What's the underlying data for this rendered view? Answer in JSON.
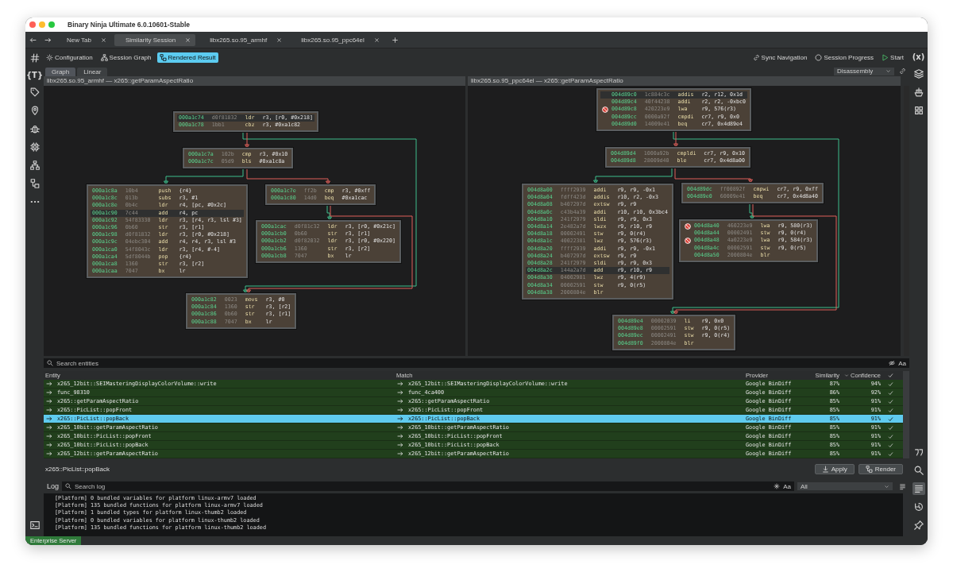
{
  "window": {
    "title": "Binary Ninja Ultimate 6.0.10601-Stable"
  },
  "tabs": [
    {
      "label": "New Tab",
      "selected": false
    },
    {
      "label": "Similarity Session",
      "selected": true
    },
    {
      "label": "libx265.so.95_armhf",
      "selected": false
    },
    {
      "label": "libx265.so.95_ppc64el",
      "selected": false
    }
  ],
  "left_sidebar": {
    "top": [
      {
        "kind": "hash",
        "selected": false
      },
      {
        "kind": "glyph",
        "text": "{T}",
        "selected": false
      },
      {
        "kind": "tag",
        "selected": false
      },
      {
        "kind": "pin",
        "selected": false
      },
      {
        "kind": "bug",
        "selected": false
      },
      {
        "kind": "chip",
        "selected": false
      },
      {
        "kind": "tree",
        "selected": false
      },
      {
        "kind": "tree2",
        "selected": false
      },
      {
        "kind": "more",
        "selected": false
      }
    ],
    "bottom": [
      {
        "kind": "terminal",
        "selected": false
      }
    ]
  },
  "right_sidebar": {
    "top": [
      {
        "kind": "glyph",
        "text": "(x)",
        "selected": false
      },
      {
        "kind": "layers",
        "selected": false
      },
      {
        "kind": "ship",
        "selected": false
      },
      {
        "kind": "grid",
        "selected": false
      }
    ],
    "bottom": [
      {
        "kind": "quote",
        "selected": false
      },
      {
        "kind": "search",
        "selected": false
      },
      {
        "kind": "list",
        "selected": true
      },
      {
        "kind": "history",
        "selected": false
      },
      {
        "kind": "pushpin",
        "selected": false
      }
    ]
  },
  "toolbar": {
    "left": [
      {
        "label": "Configuration",
        "kind": "gear",
        "selected": false
      },
      {
        "label": "Session Graph",
        "kind": "tree",
        "selected": false
      },
      {
        "label": "Rendered Result",
        "kind": "tree2",
        "selected": true
      }
    ],
    "right": [
      {
        "label": "Sync Navigation",
        "kind": "link"
      },
      {
        "label": "Session Progress",
        "kind": "circle"
      },
      {
        "label": "Start",
        "kind": "play"
      }
    ]
  },
  "view_tabs": [
    {
      "label": "Graph",
      "selected": true
    },
    {
      "label": "Linear",
      "selected": false
    }
  ],
  "view_mode": {
    "value": "Disassembly"
  },
  "graphs": [
    {
      "header": "libx265.so.95_armhf — x265::getParamAspectRatio",
      "blocks": [
        {
          "lines": [
            {
              "address": "000a1c74",
              "bytes": "d0f81832",
              "mnemonic": "ldr",
              "operands": "r3, [r0, #0x218]",
              "selected": true
            },
            {
              "address": "000a1c78",
              "bytes": "1bb1",
              "mnemonic": "cbz",
              "operands": "r3, #0xa1c82",
              "selected": false
            }
          ]
        },
        {
          "lines": [
            {
              "address": "000a1c7a",
              "bytes": "102b",
              "mnemonic": "cmp",
              "operands": "r3, #0x10",
              "selected": false
            },
            {
              "address": "000a1c7c",
              "bytes": "05d9",
              "mnemonic": "bls",
              "operands": "#0xa1c8a",
              "selected": false
            }
          ]
        },
        {
          "lines": [
            {
              "address": "000a1c8a",
              "bytes": "10b4",
              "mnemonic": "push",
              "operands": "{r4}",
              "selected": false
            },
            {
              "address": "000a1c8c",
              "bytes": "013b",
              "mnemonic": "subs",
              "operands": "r3, #1",
              "selected": false
            },
            {
              "address": "000a1c8e",
              "bytes": "0b4c",
              "mnemonic": "ldr",
              "operands": "r4, [pc, #0x2c]",
              "selected": false
            },
            {
              "address": "000a1c90",
              "bytes": "7c44",
              "mnemonic": "add",
              "operands": "r4, pc",
              "selected": true
            },
            {
              "address": "000a1c92",
              "bytes": "54f83330",
              "mnemonic": "ldr",
              "operands": "r3, [r4, r3, lsl #3]",
              "selected": false
            },
            {
              "address": "000a1c96",
              "bytes": "0b60",
              "mnemonic": "str",
              "operands": "r3, [r1]",
              "selected": false
            },
            {
              "address": "000a1c98",
              "bytes": "d0f81832",
              "mnemonic": "ldr",
              "operands": "r3, [r0, #0x218]",
              "selected": false
            },
            {
              "address": "000a1c9c",
              "bytes": "04ebc304",
              "mnemonic": "add",
              "operands": "r4, r4, r3, lsl #3",
              "selected": false
            },
            {
              "address": "000a1ca0",
              "bytes": "54f8043c",
              "mnemonic": "ldr",
              "operands": "r3, [r4, #-4]",
              "selected": false
            },
            {
              "address": "000a1ca4",
              "bytes": "5df8044b",
              "mnemonic": "pop",
              "operands": "{r4}",
              "selected": false
            },
            {
              "address": "000a1ca8",
              "bytes": "1360",
              "mnemonic": "str",
              "operands": "r3, [r2]",
              "selected": false
            },
            {
              "address": "000a1caa",
              "bytes": "7047",
              "mnemonic": "bx",
              "operands": "lr",
              "selected": false
            }
          ]
        },
        {
          "lines": [
            {
              "address": "000a1c7e",
              "bytes": "ff2b",
              "mnemonic": "cmp",
              "operands": "r3, #0xff",
              "selected": false
            },
            {
              "address": "000a1c80",
              "bytes": "14d0",
              "mnemonic": "beq",
              "operands": "#0xa1cac",
              "selected": false
            }
          ]
        },
        {
          "lines": [
            {
              "address": "000a1cac",
              "bytes": "d0f81c32",
              "mnemonic": "ldr",
              "operands": "r3, [r0, #0x21c]",
              "selected": false
            },
            {
              "address": "000a1cb0",
              "bytes": "0b60",
              "mnemonic": "str",
              "operands": "r3, [r1]",
              "selected": false
            },
            {
              "address": "000a1cb2",
              "bytes": "d0f82032",
              "mnemonic": "ldr",
              "operands": "r3, [r0, #0x220]",
              "selected": false
            },
            {
              "address": "000a1cb6",
              "bytes": "1360",
              "mnemonic": "str",
              "operands": "r3, [r2]",
              "selected": false
            },
            {
              "address": "000a1cb8",
              "bytes": "7047",
              "mnemonic": "bx",
              "operands": "lr",
              "selected": false
            }
          ]
        },
        {
          "lines": [
            {
              "address": "000a1c82",
              "bytes": "0023",
              "mnemonic": "movs",
              "operands": "r3, #0",
              "selected": false
            },
            {
              "address": "000a1c84",
              "bytes": "1360",
              "mnemonic": "str",
              "operands": "r3, [r2]",
              "selected": false
            },
            {
              "address": "000a1c86",
              "bytes": "0b60",
              "mnemonic": "str",
              "operands": "r3, [r1]",
              "selected": false
            },
            {
              "address": "000a1c88",
              "bytes": "7047",
              "mnemonic": "bx",
              "operands": "lr",
              "selected": false
            }
          ]
        }
      ]
    },
    {
      "header": "libx265.so.95_ppc64el — x265::getParamAspectRatio",
      "blocks": [
        {
          "lines": [
            {
              "address": "004d89c0",
              "bytes": "1c884c3c",
              "mnemonic": "addis",
              "operands": "r2, r12, 0x1d",
              "selected": true,
              "marked": false
            },
            {
              "address": "004d89c4",
              "bytes": "40f44238",
              "mnemonic": "addi",
              "operands": "r2, r2, -0xbc0",
              "selected": false,
              "marked": false
            },
            {
              "address": "004d89c8",
              "bytes": "420223e9",
              "mnemonic": "lwa",
              "operands": "r9, 576(r3)",
              "selected": false,
              "marked": true
            },
            {
              "address": "004d89cc",
              "bytes": "0000a92f",
              "mnemonic": "cmpdi",
              "operands": "cr7, r9, 0x0",
              "selected": false,
              "marked": false
            },
            {
              "address": "004d89d0",
              "bytes": "14009e41",
              "mnemonic": "beq",
              "operands": "cr7, 0x4d89e4",
              "selected": false,
              "marked": false
            }
          ]
        },
        {
          "lines": [
            {
              "address": "004d89d4",
              "bytes": "1000a92b",
              "mnemonic": "cmpldi",
              "operands": "cr7, r9, 0x10",
              "selected": false
            },
            {
              "address": "004d89d8",
              "bytes": "28009d40",
              "mnemonic": "ble",
              "operands": "cr7, 0x4d8a00",
              "selected": false
            }
          ]
        },
        {
          "lines": [
            {
              "address": "004d8a00",
              "bytes": "ffff2939",
              "mnemonic": "addi",
              "operands": "r9, r9, -0x1",
              "selected": false
            },
            {
              "address": "004d8a04",
              "bytes": "fdff423d",
              "mnemonic": "addis",
              "operands": "r10, r2, -0x3",
              "selected": false
            },
            {
              "address": "004d8a08",
              "bytes": "b407297d",
              "mnemonic": "extsw",
              "operands": "r9, r9",
              "selected": false
            },
            {
              "address": "004d8a0c",
              "bytes": "c43b4a39",
              "mnemonic": "addi",
              "operands": "r10, r10, 0x3bc4",
              "selected": false
            },
            {
              "address": "004d8a10",
              "bytes": "241f2979",
              "mnemonic": "sldi",
              "operands": "r9, r9, 0x3",
              "selected": false
            },
            {
              "address": "004d8a14",
              "bytes": "2e482a7d",
              "mnemonic": "lwzx",
              "operands": "r9, r10, r9",
              "selected": false
            },
            {
              "address": "004d8a18",
              "bytes": "00002491",
              "mnemonic": "stw",
              "operands": "r9, 0(r4)",
              "selected": false
            },
            {
              "address": "004d8a1c",
              "bytes": "40022381",
              "mnemonic": "lwz",
              "operands": "r9, 576(r3)",
              "selected": false
            },
            {
              "address": "004d8a20",
              "bytes": "ffff2939",
              "mnemonic": "addi",
              "operands": "r9, r9, -0x1",
              "selected": false
            },
            {
              "address": "004d8a24",
              "bytes": "b407297d",
              "mnemonic": "extsw",
              "operands": "r9, r9",
              "selected": false
            },
            {
              "address": "004d8a28",
              "bytes": "241f2979",
              "mnemonic": "sldi",
              "operands": "r9, r9, 0x3",
              "selected": false
            },
            {
              "address": "004d8a2c",
              "bytes": "144a2a7d",
              "mnemonic": "add",
              "operands": "r9, r10, r9",
              "selected": true
            },
            {
              "address": "004d8a30",
              "bytes": "04002981",
              "mnemonic": "lwz",
              "operands": "r9, 4(r9)",
              "selected": false
            },
            {
              "address": "004d8a34",
              "bytes": "00002591",
              "mnemonic": "stw",
              "operands": "r9, 0(r5)",
              "selected": false
            },
            {
              "address": "004d8a38",
              "bytes": "2000804e",
              "mnemonic": "blr",
              "selected": false
            }
          ]
        },
        {
          "lines": [
            {
              "address": "004d89dc",
              "bytes": "ff00892f",
              "mnemonic": "cmpwi",
              "operands": "cr7, r9, 0xff",
              "selected": false
            },
            {
              "address": "004d89e0",
              "bytes": "60009e41",
              "mnemonic": "beq",
              "operands": "cr7, 0x4d8a40",
              "selected": false
            }
          ]
        },
        {
          "lines": [
            {
              "address": "004d8a40",
              "bytes": "460223e9",
              "mnemonic": "lwa",
              "operands": "r9, 580(r3)",
              "selected": false,
              "marked": true
            },
            {
              "address": "004d8a44",
              "bytes": "00002491",
              "mnemonic": "stw",
              "operands": "r9, 0(r4)",
              "selected": false,
              "marked": false
            },
            {
              "address": "004d8a48",
              "bytes": "4a0223e9",
              "mnemonic": "lwa",
              "operands": "r9, 584(r3)",
              "selected": false,
              "marked": true
            },
            {
              "address": "004d8a4c",
              "bytes": "00002591",
              "mnemonic": "stw",
              "operands": "r9, 0(r5)",
              "selected": false,
              "marked": false
            },
            {
              "address": "004d8a50",
              "bytes": "2000804e",
              "mnemonic": "blr",
              "selected": false,
              "marked": false
            }
          ]
        },
        {
          "lines": [
            {
              "address": "004d89e4",
              "bytes": "00002039",
              "mnemonic": "li",
              "operands": "r9, 0x0",
              "selected": false
            },
            {
              "address": "004d89e8",
              "bytes": "00002591",
              "mnemonic": "stw",
              "operands": "r9, 0(r5)",
              "selected": false
            },
            {
              "address": "004d89ec",
              "bytes": "00002491",
              "mnemonic": "stw",
              "operands": "r9, 0(r4)",
              "selected": false
            },
            {
              "address": "004d89f0",
              "bytes": "2000804e",
              "mnemonic": "blr",
              "selected": false
            }
          ]
        }
      ]
    }
  ],
  "entity_search": {
    "placeholder": "Search entities",
    "case_label": "Aa"
  },
  "table": {
    "columns": [
      "Entity",
      "Match",
      "Provider",
      "Similarity",
      "Confidence"
    ],
    "rows": [
      {
        "entity": "x265_12bit::SEIMasteringDisplayColorVolume::write",
        "match": "x265_12bit::SEIMasteringDisplayColorVolume::write",
        "provider": "Google BinDiff",
        "similarity": "87%",
        "confidence": "94%",
        "accepted": true,
        "selected": false
      },
      {
        "entity": "func_98310",
        "match": "func_4ca400",
        "provider": "Google BinDiff",
        "similarity": "86%",
        "confidence": "92%",
        "accepted": true,
        "selected": false
      },
      {
        "entity": "x265::getParamAspectRatio",
        "match": "x265::getParamAspectRatio",
        "provider": "Google BinDiff",
        "similarity": "85%",
        "confidence": "91%",
        "accepted": true,
        "selected": false
      },
      {
        "entity": "x265::PicList::popFront",
        "match": "x265::PicList::popFront",
        "provider": "Google BinDiff",
        "similarity": "85%",
        "confidence": "91%",
        "accepted": true,
        "selected": false
      },
      {
        "entity": "x265::PicList::popBack",
        "match": "x265::PicList::popBack",
        "provider": "Google BinDiff",
        "similarity": "85%",
        "confidence": "91%",
        "accepted": true,
        "selected": true
      },
      {
        "entity": "x265_10bit::getParamAspectRatio",
        "match": "x265_10bit::getParamAspectRatio",
        "provider": "Google BinDiff",
        "similarity": "85%",
        "confidence": "91%",
        "accepted": true,
        "selected": false
      },
      {
        "entity": "x265_10bit::PicList::popFront",
        "match": "x265_10bit::PicList::popFront",
        "provider": "Google BinDiff",
        "similarity": "85%",
        "confidence": "91%",
        "accepted": true,
        "selected": false
      },
      {
        "entity": "x265_10bit::PicList::popBack",
        "match": "x265_10bit::PicList::popBack",
        "provider": "Google BinDiff",
        "similarity": "85%",
        "confidence": "91%",
        "accepted": true,
        "selected": false
      },
      {
        "entity": "x265_12bit::getParamAspectRatio",
        "match": "x265_12bit::getParamAspectRatio",
        "provider": "Google BinDiff",
        "similarity": "85%",
        "confidence": "91%",
        "accepted": true,
        "selected": false
      }
    ]
  },
  "selection": {
    "name": "x265::PicList::popBack",
    "buttons": [
      {
        "label": "Apply",
        "kind": "download"
      },
      {
        "label": "Render",
        "kind": "tree2"
      }
    ]
  },
  "log": {
    "title": "Log",
    "placeholder": "Search log",
    "case_label": "Aa",
    "filter": "All",
    "lines": [
      "[Platform] 0 bundled variables for platform linux-armv7 loaded",
      "[Platform] 135 bundled functions for platform linux-armv7 loaded",
      "[Platform] 1 bundled types for platform linux-thumb2 loaded",
      "[Platform] 0 bundled variables for platform linux-thumb2 loaded",
      "[Platform] 135 bundled functions for platform linux-thumb2 loaded"
    ]
  },
  "status_bar": {
    "server": "Enterprise Server"
  }
}
